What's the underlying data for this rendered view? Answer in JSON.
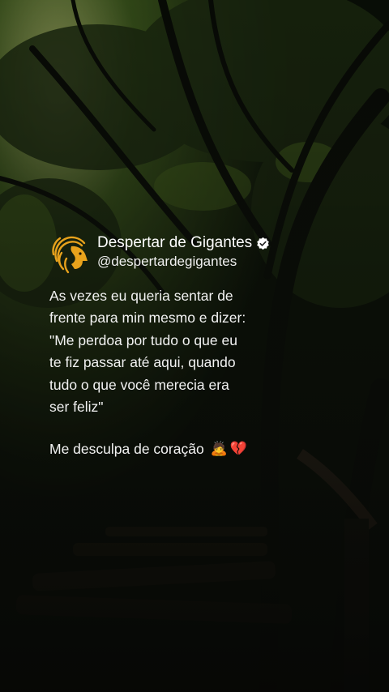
{
  "post": {
    "account_name": "Despertar de Gigantes",
    "handle": "@despertardegigantes",
    "verified": true,
    "quote_lines": "As vezes eu queria sentar de\nfrente para min mesmo e dizer:\n\"Me perdoa por tudo o que eu\nte fiz passar até aqui, quando\ntudo o que você merecia era\nser feliz\"",
    "closing_text": "Me desculpa de coração",
    "closing_emoji_1": "🙇",
    "closing_emoji_2": "💔"
  },
  "icons": [
    "lion-logo-icon",
    "verified-badge-icon"
  ],
  "colors": {
    "text": "#ffffff",
    "logo_gold": "#e8a21c",
    "background_dark": "#0c130a",
    "foliage_green": "#5a7a2a"
  }
}
